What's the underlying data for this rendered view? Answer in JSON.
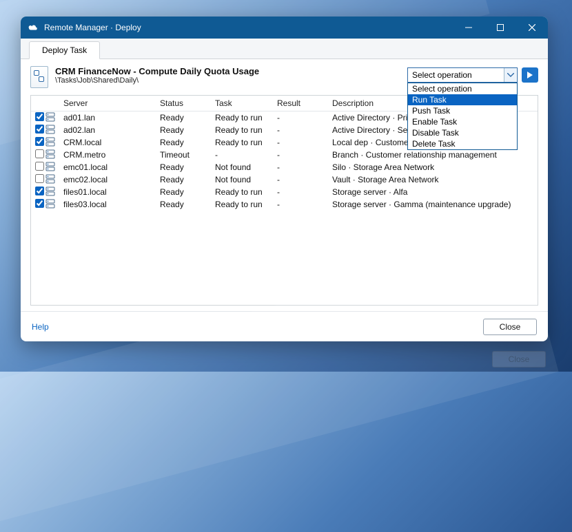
{
  "window": {
    "title": "Remote Manager · Deploy"
  },
  "tabs": [
    {
      "label": "Deploy Task"
    }
  ],
  "task": {
    "title": "CRM FinanceNow - Compute Daily Quota Usage",
    "path": "\\Tasks\\Job\\Shared\\Daily\\"
  },
  "operation": {
    "selected": "Select operation",
    "options": [
      "Select operation",
      "Run Task",
      "Push Task",
      "Enable Task",
      "Disable Task",
      "Delete Task"
    ],
    "highlight_index": 1
  },
  "grid": {
    "columns": [
      "Server",
      "Status",
      "Task",
      "Result",
      "Description"
    ],
    "rows": [
      {
        "checked": true,
        "server": "ad01.lan",
        "status": "Ready",
        "task": "Ready to run",
        "result": "-",
        "description": "Active Directory · Prim"
      },
      {
        "checked": true,
        "server": "ad02.lan",
        "status": "Ready",
        "task": "Ready to run",
        "result": "-",
        "description": "Active Directory · Sec"
      },
      {
        "checked": true,
        "server": "CRM.local",
        "status": "Ready",
        "task": "Ready to run",
        "result": "-",
        "description": "Local dep · Customer"
      },
      {
        "checked": false,
        "server": "CRM.metro",
        "status": "Timeout",
        "task": "-",
        "result": "-",
        "description": "Branch · Customer relationship management"
      },
      {
        "checked": false,
        "server": "emc01.local",
        "status": "Ready",
        "task": "Not found",
        "result": "-",
        "description": "Silo · Storage Area Network"
      },
      {
        "checked": false,
        "server": "emc02.local",
        "status": "Ready",
        "task": "Not found",
        "result": "-",
        "description": "Vault · Storage Area Network"
      },
      {
        "checked": true,
        "server": "files01.local",
        "status": "Ready",
        "task": "Ready to run",
        "result": "-",
        "description": "Storage server · Alfa"
      },
      {
        "checked": true,
        "server": "files03.local",
        "status": "Ready",
        "task": "Ready to run",
        "result": "-",
        "description": "Storage server · Gamma (maintenance upgrade)"
      }
    ]
  },
  "footer": {
    "help": "Help",
    "close": "Close"
  },
  "shadow": {
    "close": "Close"
  }
}
